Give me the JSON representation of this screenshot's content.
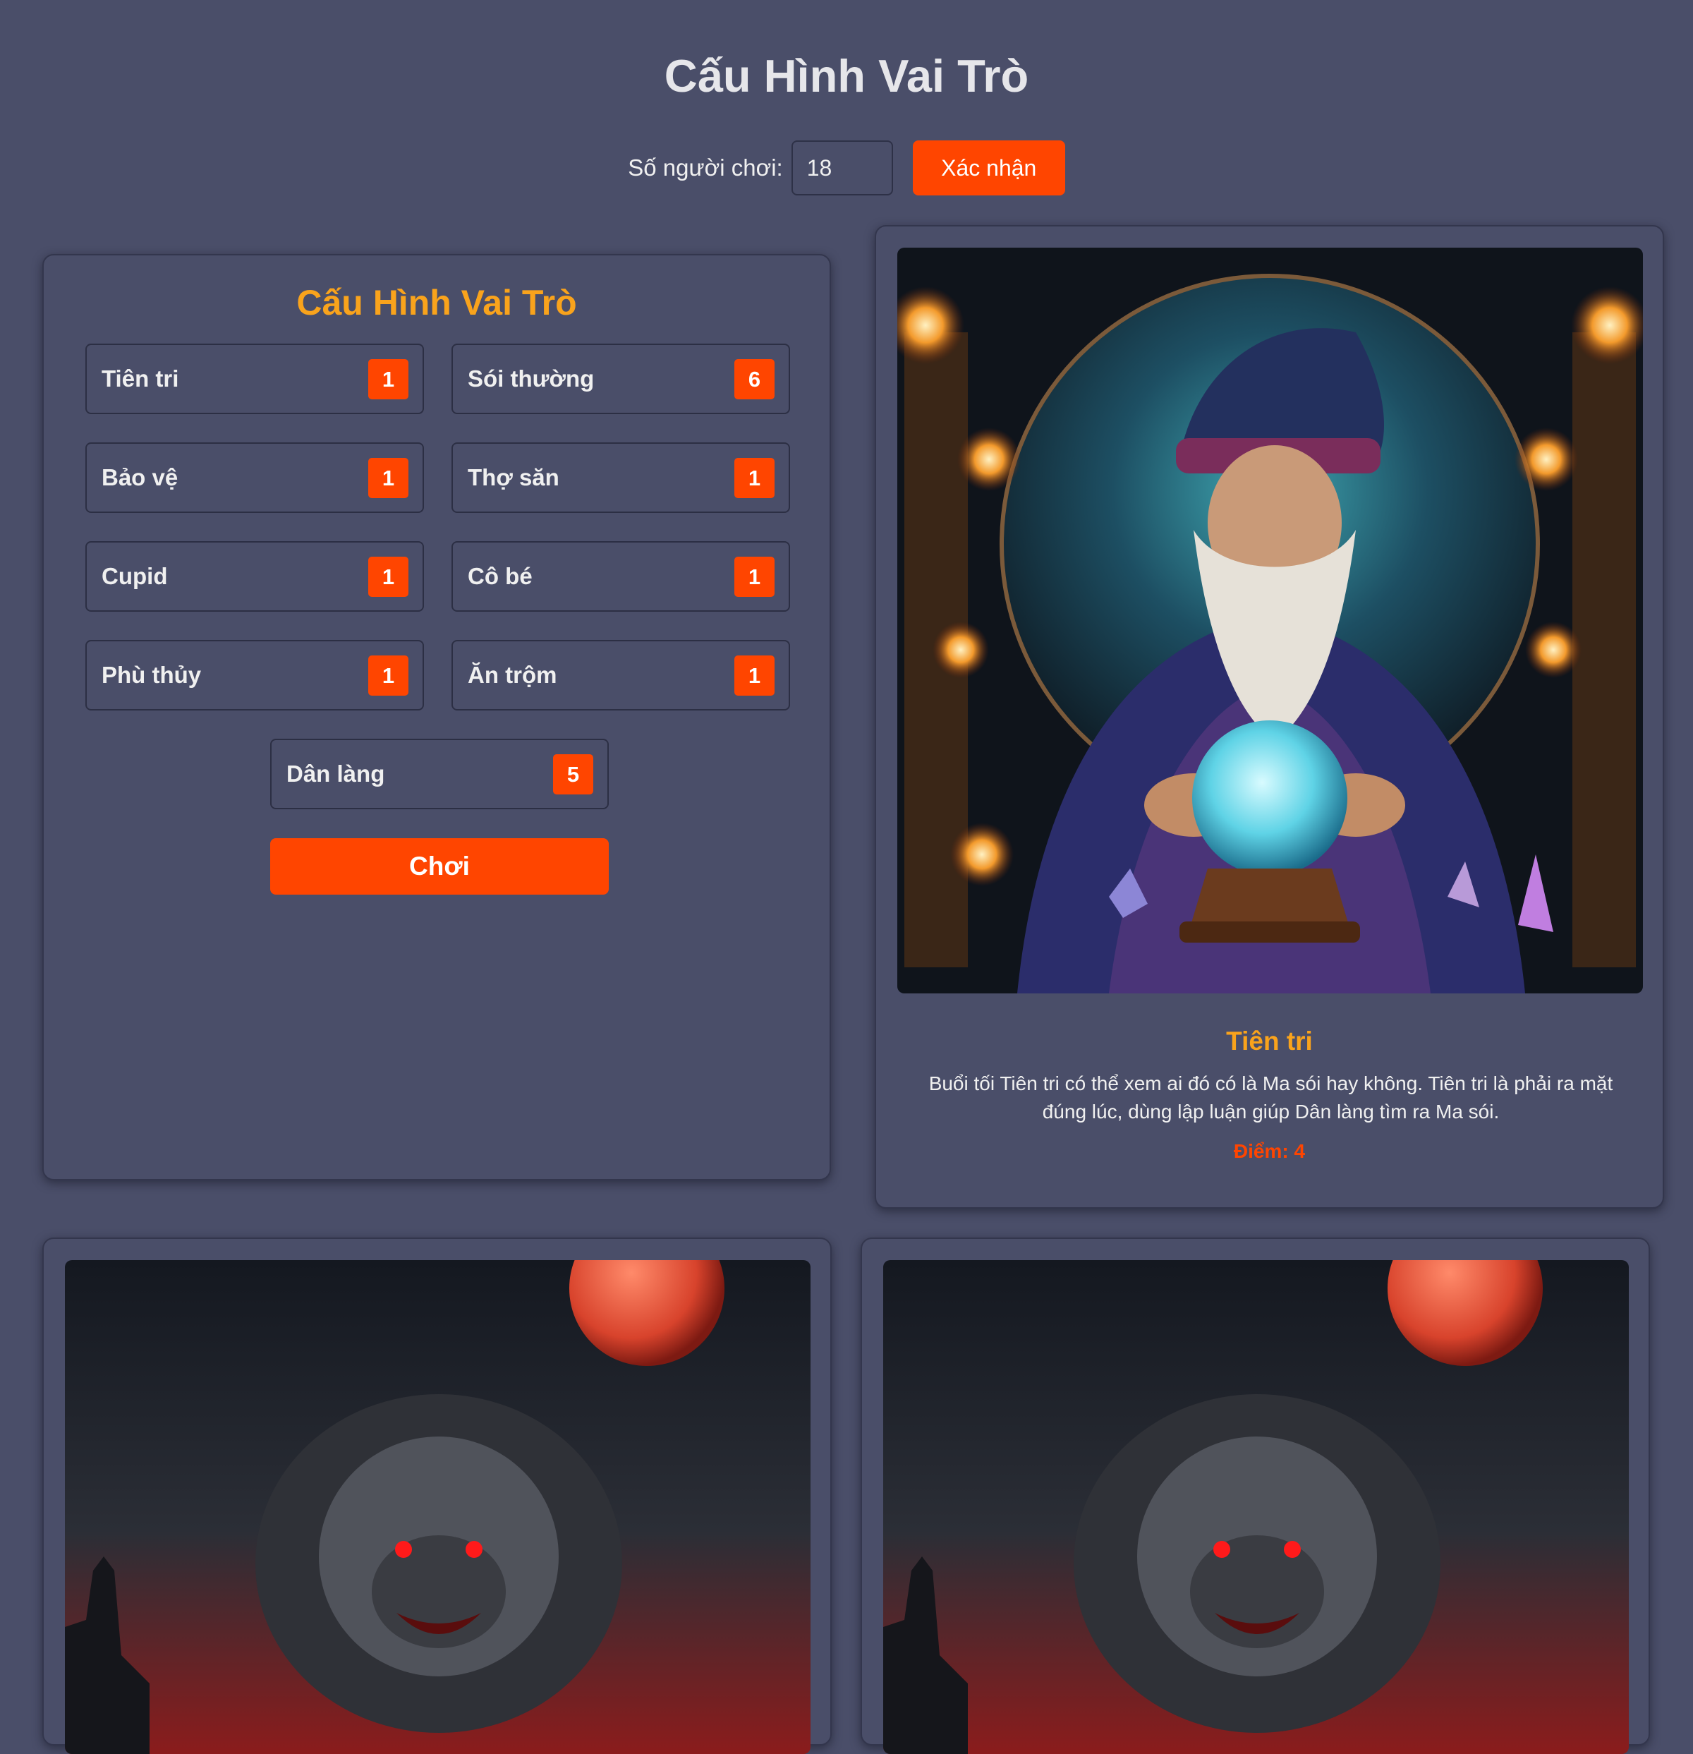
{
  "header": {
    "title": "Cấu Hình Vai Trò"
  },
  "players": {
    "label": "Số người chơi:",
    "value": "18",
    "confirm_label": "Xác nhận"
  },
  "config": {
    "title": "Cấu Hình Vai Trò",
    "roles": [
      {
        "name": "Tiên tri",
        "count": "1"
      },
      {
        "name": "Sói thường",
        "count": "6"
      },
      {
        "name": "Bảo vệ",
        "count": "1"
      },
      {
        "name": "Thợ săn",
        "count": "1"
      },
      {
        "name": "Cupid",
        "count": "1"
      },
      {
        "name": "Cô bé",
        "count": "1"
      },
      {
        "name": "Phù thủy",
        "count": "1"
      },
      {
        "name": "Ăn trộm",
        "count": "1"
      },
      {
        "name": "Dân làng",
        "count": "5"
      }
    ],
    "play_label": "Chơi"
  },
  "detail": {
    "role_name": "Tiên tri",
    "description": "Buổi tối Tiên tri có thể xem ai đó có là Ma sói hay không. Tiên tri là phải ra mặt đúng lúc, dùng lập luận giúp Dân làng tìm ra Ma sói.",
    "score": "Điểm: 4",
    "image": "seer-wizard-crystal-ball-illustration"
  },
  "cards": [
    {
      "image": "werewolf-blood-moon-illustration"
    },
    {
      "image": "werewolf-blood-moon-illustration"
    }
  ],
  "colors": {
    "background": "#4a4e69",
    "accent": "#ff4500",
    "title_gold": "#f9a31c"
  }
}
